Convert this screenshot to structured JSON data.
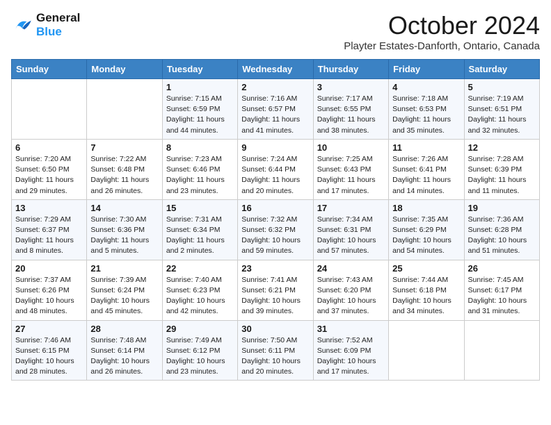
{
  "header": {
    "logo_line1": "General",
    "logo_line2": "Blue",
    "month": "October 2024",
    "location": "Playter Estates-Danforth, Ontario, Canada"
  },
  "weekdays": [
    "Sunday",
    "Monday",
    "Tuesday",
    "Wednesday",
    "Thursday",
    "Friday",
    "Saturday"
  ],
  "weeks": [
    [
      {
        "day": "",
        "info": ""
      },
      {
        "day": "",
        "info": ""
      },
      {
        "day": "1",
        "info": "Sunrise: 7:15 AM\nSunset: 6:59 PM\nDaylight: 11 hours and 44 minutes."
      },
      {
        "day": "2",
        "info": "Sunrise: 7:16 AM\nSunset: 6:57 PM\nDaylight: 11 hours and 41 minutes."
      },
      {
        "day": "3",
        "info": "Sunrise: 7:17 AM\nSunset: 6:55 PM\nDaylight: 11 hours and 38 minutes."
      },
      {
        "day": "4",
        "info": "Sunrise: 7:18 AM\nSunset: 6:53 PM\nDaylight: 11 hours and 35 minutes."
      },
      {
        "day": "5",
        "info": "Sunrise: 7:19 AM\nSunset: 6:51 PM\nDaylight: 11 hours and 32 minutes."
      }
    ],
    [
      {
        "day": "6",
        "info": "Sunrise: 7:20 AM\nSunset: 6:50 PM\nDaylight: 11 hours and 29 minutes."
      },
      {
        "day": "7",
        "info": "Sunrise: 7:22 AM\nSunset: 6:48 PM\nDaylight: 11 hours and 26 minutes."
      },
      {
        "day": "8",
        "info": "Sunrise: 7:23 AM\nSunset: 6:46 PM\nDaylight: 11 hours and 23 minutes."
      },
      {
        "day": "9",
        "info": "Sunrise: 7:24 AM\nSunset: 6:44 PM\nDaylight: 11 hours and 20 minutes."
      },
      {
        "day": "10",
        "info": "Sunrise: 7:25 AM\nSunset: 6:43 PM\nDaylight: 11 hours and 17 minutes."
      },
      {
        "day": "11",
        "info": "Sunrise: 7:26 AM\nSunset: 6:41 PM\nDaylight: 11 hours and 14 minutes."
      },
      {
        "day": "12",
        "info": "Sunrise: 7:28 AM\nSunset: 6:39 PM\nDaylight: 11 hours and 11 minutes."
      }
    ],
    [
      {
        "day": "13",
        "info": "Sunrise: 7:29 AM\nSunset: 6:37 PM\nDaylight: 11 hours and 8 minutes."
      },
      {
        "day": "14",
        "info": "Sunrise: 7:30 AM\nSunset: 6:36 PM\nDaylight: 11 hours and 5 minutes."
      },
      {
        "day": "15",
        "info": "Sunrise: 7:31 AM\nSunset: 6:34 PM\nDaylight: 11 hours and 2 minutes."
      },
      {
        "day": "16",
        "info": "Sunrise: 7:32 AM\nSunset: 6:32 PM\nDaylight: 10 hours and 59 minutes."
      },
      {
        "day": "17",
        "info": "Sunrise: 7:34 AM\nSunset: 6:31 PM\nDaylight: 10 hours and 57 minutes."
      },
      {
        "day": "18",
        "info": "Sunrise: 7:35 AM\nSunset: 6:29 PM\nDaylight: 10 hours and 54 minutes."
      },
      {
        "day": "19",
        "info": "Sunrise: 7:36 AM\nSunset: 6:28 PM\nDaylight: 10 hours and 51 minutes."
      }
    ],
    [
      {
        "day": "20",
        "info": "Sunrise: 7:37 AM\nSunset: 6:26 PM\nDaylight: 10 hours and 48 minutes."
      },
      {
        "day": "21",
        "info": "Sunrise: 7:39 AM\nSunset: 6:24 PM\nDaylight: 10 hours and 45 minutes."
      },
      {
        "day": "22",
        "info": "Sunrise: 7:40 AM\nSunset: 6:23 PM\nDaylight: 10 hours and 42 minutes."
      },
      {
        "day": "23",
        "info": "Sunrise: 7:41 AM\nSunset: 6:21 PM\nDaylight: 10 hours and 39 minutes."
      },
      {
        "day": "24",
        "info": "Sunrise: 7:43 AM\nSunset: 6:20 PM\nDaylight: 10 hours and 37 minutes."
      },
      {
        "day": "25",
        "info": "Sunrise: 7:44 AM\nSunset: 6:18 PM\nDaylight: 10 hours and 34 minutes."
      },
      {
        "day": "26",
        "info": "Sunrise: 7:45 AM\nSunset: 6:17 PM\nDaylight: 10 hours and 31 minutes."
      }
    ],
    [
      {
        "day": "27",
        "info": "Sunrise: 7:46 AM\nSunset: 6:15 PM\nDaylight: 10 hours and 28 minutes."
      },
      {
        "day": "28",
        "info": "Sunrise: 7:48 AM\nSunset: 6:14 PM\nDaylight: 10 hours and 26 minutes."
      },
      {
        "day": "29",
        "info": "Sunrise: 7:49 AM\nSunset: 6:12 PM\nDaylight: 10 hours and 23 minutes."
      },
      {
        "day": "30",
        "info": "Sunrise: 7:50 AM\nSunset: 6:11 PM\nDaylight: 10 hours and 20 minutes."
      },
      {
        "day": "31",
        "info": "Sunrise: 7:52 AM\nSunset: 6:09 PM\nDaylight: 10 hours and 17 minutes."
      },
      {
        "day": "",
        "info": ""
      },
      {
        "day": "",
        "info": ""
      }
    ]
  ]
}
